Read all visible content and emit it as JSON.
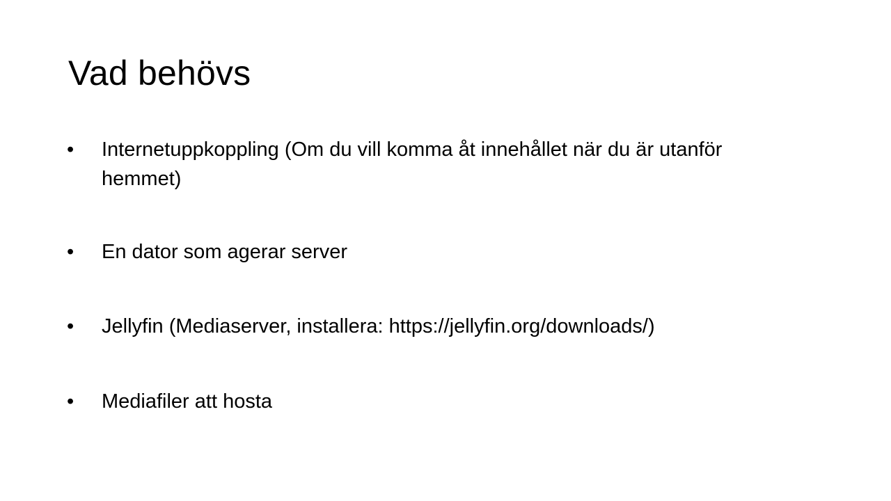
{
  "slide": {
    "title": "Vad behövs",
    "bullet_glyph": "•",
    "items": [
      {
        "text": "Internetuppkoppling (Om du vill komma åt innehållet när du är utanför hemmet)"
      },
      {
        "text": "En dator som agerar server"
      },
      {
        "text": "Jellyfin (Mediaserver, installera: https://jellyfin.org/downloads/)"
      },
      {
        "text": "Mediafiler att hosta"
      }
    ]
  },
  "colors": {
    "background": "#ffffff",
    "text": "#000000"
  }
}
